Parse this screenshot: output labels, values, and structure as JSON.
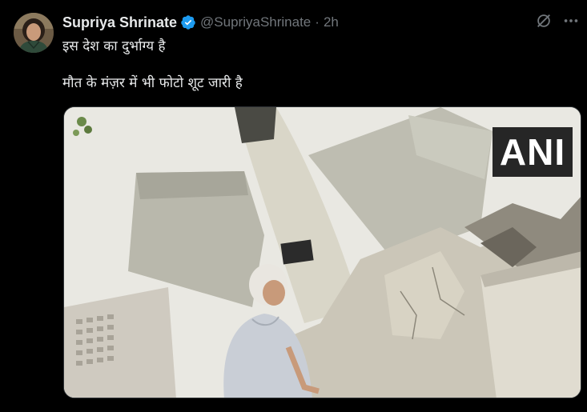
{
  "author": {
    "display_name": "Supriya Shrinate",
    "handle": "@SupriyaShrinate",
    "separator": "·",
    "time": "2h",
    "verified_icon": "verified-badge-icon"
  },
  "post": {
    "line1": "इस देश का दुर्भाग्य है",
    "line2": "मौत के मंज़र में भी फोटो शूट जारी है"
  },
  "media": {
    "watermark": "ANI",
    "alt_description_icon": "photo"
  },
  "actions": {
    "grok_icon": "grok-slash-icon",
    "more_icon": "more-dots-icon"
  },
  "colors": {
    "background": "#000000",
    "text_primary": "#e7e9ea",
    "text_secondary": "#71767b",
    "verified": "#1d9bf0"
  }
}
